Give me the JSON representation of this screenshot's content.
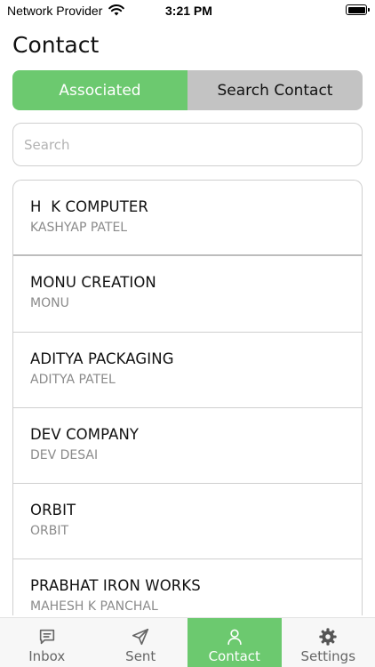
{
  "status_bar": {
    "carrier": "Network Provider",
    "time": "3:21 PM"
  },
  "page": {
    "title": "Contact"
  },
  "segments": {
    "associated": "Associated",
    "search_contact": "Search Contact",
    "active": "associated"
  },
  "search": {
    "placeholder": "Search",
    "value": ""
  },
  "contacts": [
    {
      "name": "H  K COMPUTER",
      "person": "KASHYAP PATEL"
    },
    {
      "name": "MONU CREATION",
      "person": "MONU"
    },
    {
      "name": "ADITYA PACKAGING",
      "person": "ADITYA PATEL"
    },
    {
      "name": "DEV COMPANY",
      "person": "DEV DESAI"
    },
    {
      "name": "ORBIT",
      "person": "ORBIT"
    },
    {
      "name": "PRABHAT IRON WORKS",
      "person": "MAHESH K PANCHAL"
    }
  ],
  "tab_bar": {
    "inbox": "Inbox",
    "sent": "Sent",
    "contact": "Contact",
    "settings": "Settings",
    "active": "contact"
  },
  "colors": {
    "accent": "#6cc96f",
    "inactive_segment": "#c3c3c3",
    "border": "#cfcfcf",
    "subtext": "#8a8a8a"
  },
  "icons": {
    "inbox": "inbox-icon",
    "sent": "send-icon",
    "contact": "person-icon",
    "settings": "gear-icon"
  }
}
